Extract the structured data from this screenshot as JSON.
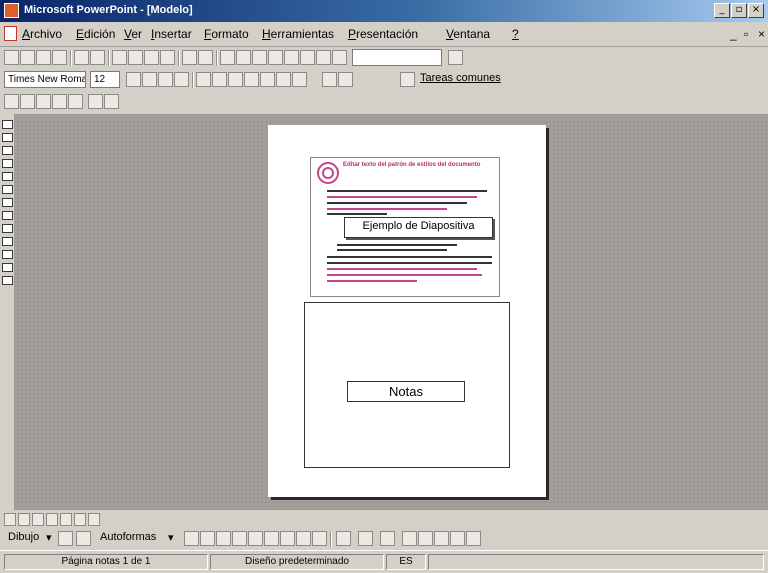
{
  "window": {
    "title": "Microsoft PowerPoint - [Modelo]"
  },
  "menu": {
    "items": [
      {
        "key": "A",
        "rest": "rchivo"
      },
      {
        "key": "E",
        "rest": "dición"
      },
      {
        "key": "V",
        "rest": "er"
      },
      {
        "key": "I",
        "rest": "nsertar"
      },
      {
        "key": "F",
        "rest": "ormato"
      },
      {
        "key": "H",
        "rest": "erramientas"
      },
      {
        "key": "P",
        "rest": "resentación"
      },
      {
        "key": "V",
        "rest": "entana"
      },
      {
        "key": "?",
        "rest": ""
      }
    ]
  },
  "formatting": {
    "font": "Times New Roman",
    "size": "12"
  },
  "toolbar": {
    "tareas_comunes": "Tareas comunes"
  },
  "slide_thumbnail": {
    "heading": "Editar texto del patrón de estilos del documento",
    "callout": "Ejemplo de Diapositiva"
  },
  "notes": {
    "label": "Notas"
  },
  "drawing": {
    "dibujo": "Dibujo",
    "autoformas": "Autoformas"
  },
  "status": {
    "page": "Página notas 1 de 1",
    "design": "Diseño predeterminado",
    "lang": "ES"
  },
  "colors": {
    "accent": "#c0488a",
    "titlebar": "#0a246a"
  }
}
